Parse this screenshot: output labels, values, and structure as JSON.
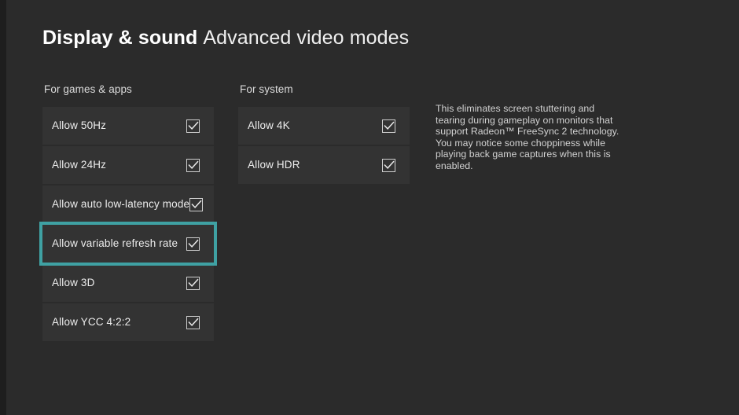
{
  "header": {
    "title": "Display & sound",
    "subtitle": "Advanced video modes"
  },
  "columns": {
    "games": {
      "label": "For games & apps",
      "items": [
        {
          "label": "Allow 50Hz",
          "checked": true,
          "focused": false
        },
        {
          "label": "Allow 24Hz",
          "checked": true,
          "focused": false
        },
        {
          "label": "Allow auto low-latency mode",
          "checked": true,
          "focused": false
        },
        {
          "label": "Allow variable refresh rate",
          "checked": true,
          "focused": true
        },
        {
          "label": "Allow 3D",
          "checked": true,
          "focused": false
        },
        {
          "label": "Allow YCC 4:2:2",
          "checked": true,
          "focused": false
        }
      ]
    },
    "system": {
      "label": "For system",
      "items": [
        {
          "label": "Allow 4K",
          "checked": true,
          "focused": false
        },
        {
          "label": "Allow HDR",
          "checked": true,
          "focused": false
        }
      ]
    }
  },
  "description": {
    "text": "This eliminates screen stuttering and tearing during gameplay on monitors that support Radeon™ FreeSync 2 technology. You may notice some choppiness while playing back game captures when this is enabled."
  },
  "colors": {
    "background": "#2b2b2b",
    "row_background": "#333333",
    "focus_accent": "#3fa1a3",
    "text_primary": "#ededed"
  },
  "icons": {
    "checkbox": "checkmark-icon"
  }
}
